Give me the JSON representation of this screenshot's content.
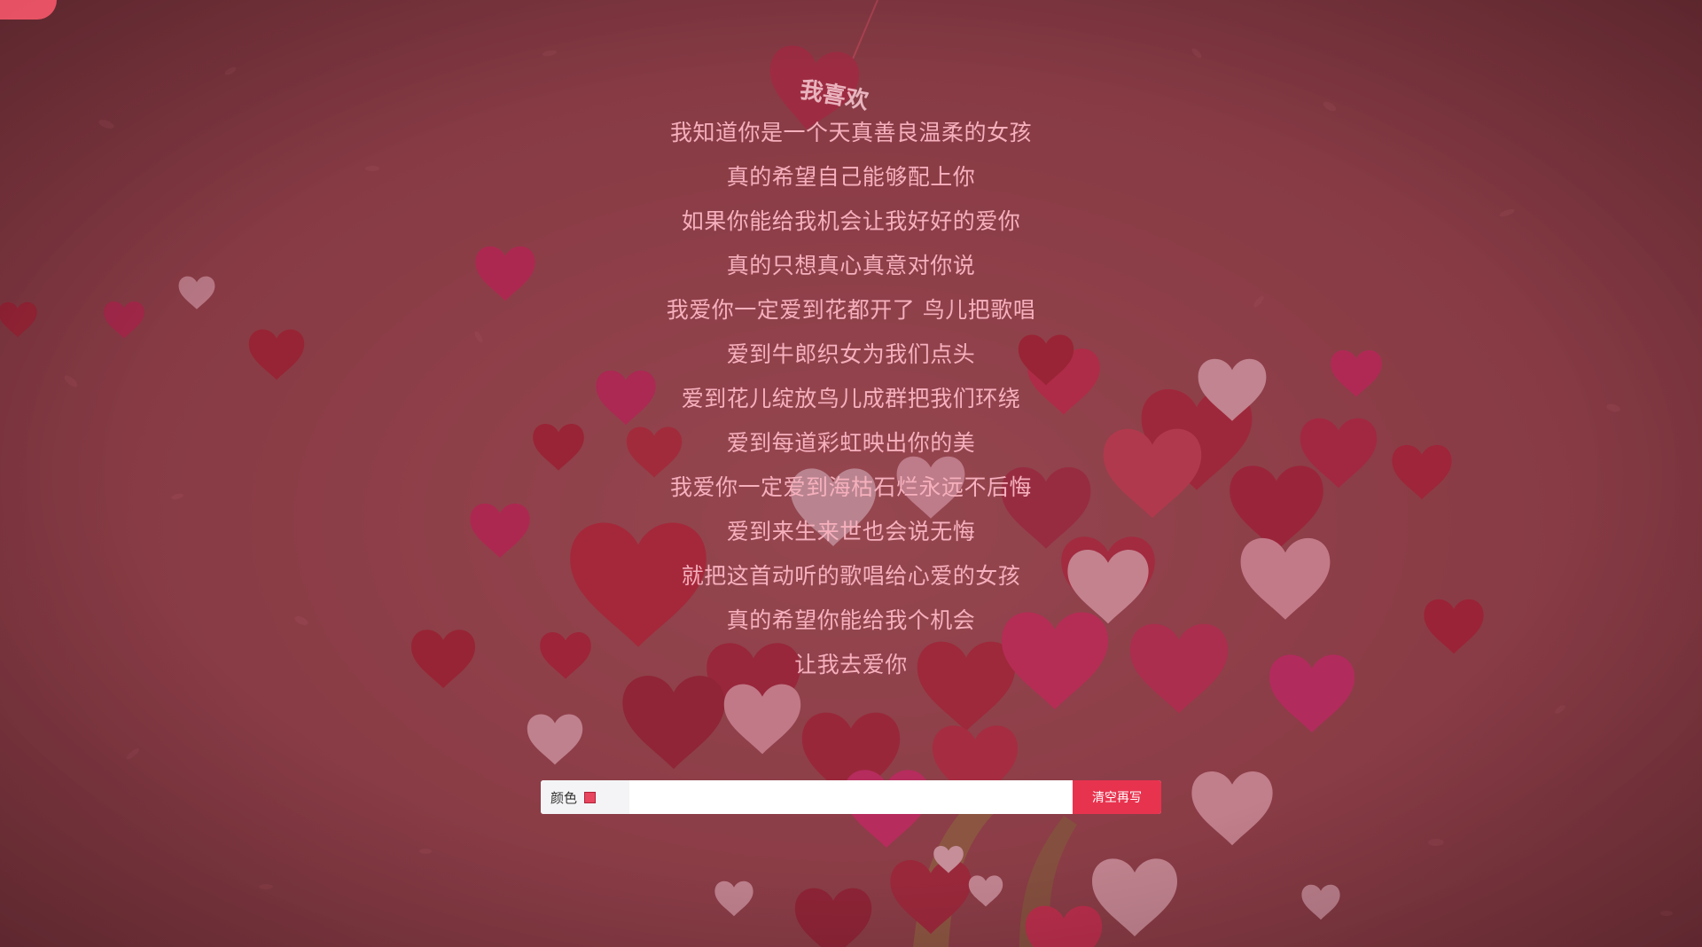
{
  "lyrics": [
    "我知道你是一个天真善良温柔的女孩",
    "真的希望自己能够配上你",
    "如果你能给我机会让我好好的爱你",
    "真的只想真心真意对你说",
    "我爱你一定爱到花都开了 鸟儿把歌唱",
    "爱到牛郎织女为我们点头",
    "爱到花儿绽放鸟儿成群把我们环绕",
    "爱到每道彩虹映出你的美",
    "我爱你一定爱到海枯石烂永远不后悔",
    "爱到来生来世也会说无悔",
    "就把这首动听的歌唱给心爱的女孩",
    "真的希望你能给我个机会",
    "让我去爱你"
  ],
  "tag": {
    "text": "我喜欢"
  },
  "input_bar": {
    "color_label": "颜色",
    "input_value": "",
    "input_placeholder": "",
    "clear_button_label": "清空再写"
  },
  "colors": {
    "swatch": "#e8455e",
    "button": "#e8334f",
    "lyrics": "#f6b0bd",
    "background": "#8a3a44"
  }
}
